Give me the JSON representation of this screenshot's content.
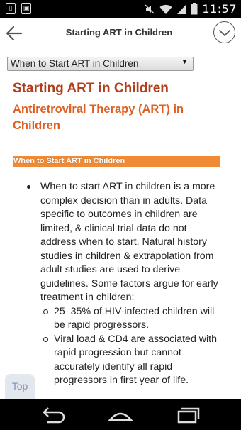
{
  "status_bar": {
    "time": "11:57",
    "left_icons": [
      "sim-card-icon",
      "image-icon"
    ],
    "right_icons": [
      "mute-icon",
      "wifi-icon",
      "signal-icon",
      "battery-icon"
    ]
  },
  "action_bar": {
    "title": "Starting ART in Children",
    "back_icon": "back-arrow-icon",
    "menu_icon": "chevron-down-icon"
  },
  "section_select": {
    "selected": "When to Start ART in Children"
  },
  "article": {
    "heading": "Starting ART in Children",
    "subheading": "Antiretroviral Therapy (ART) in Children",
    "section_label": "When to Start ART in Children",
    "bullet_text": "When to start ART in children is a more complex decision than in adults. Data specific to outcomes in children are limited, & clinical trial data do not address when to start. Natural history studies in children & extrapolation from adult studies are used to derive guidelines. Some factors argue for early treatment in children:",
    "sub_bullets": [
      "25–35% of HIV-infected children will be rapid progressors.",
      "Viral load & CD4 are associated with rapid progression but cannot accurately identify all rapid progressors in first year of life."
    ]
  },
  "top_button": {
    "label": "Top"
  },
  "nav_bar": {
    "buttons": [
      "back-nav-icon",
      "home-nav-icon",
      "recent-apps-icon"
    ]
  },
  "colors": {
    "heading": "#b23d1a",
    "subheading": "#e05e1f",
    "section_bar": "#f08a35",
    "top_button_text": "#7d93b8"
  }
}
